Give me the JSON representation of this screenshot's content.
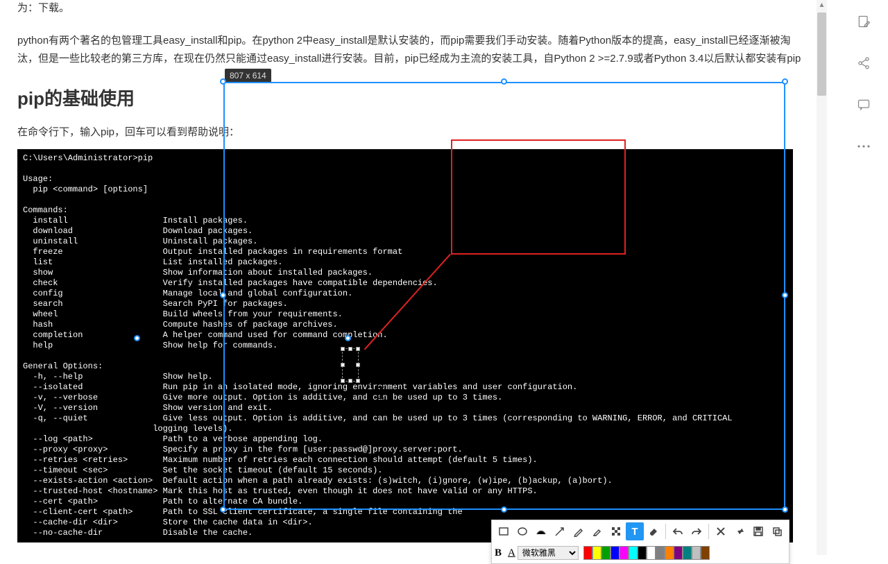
{
  "truncated_top": "为：下载。",
  "para1": "python有两个著名的包管理工具easy_install和pip。在python 2中easy_install是默认安装的，而pip需要我们手动安装。随着Python版本的提高，easy_install已经逐渐被淘汰，但是一些比较老的第三方库，在现在仍然只能通过easy_install进行安装。目前，pip已经成为主流的安装工具，自Python 2 >=2.7.9或者Python 3.4以后默认都安装有pip",
  "heading": "pip的基础使用",
  "para2": "在命令行下，输入pip，回车可以看到帮助说明：",
  "terminal": {
    "prompt": "C:\\Users\\Administrator>pip",
    "usage_header": "Usage:",
    "usage_line": "  pip <command> [options]",
    "commands_header": "Commands:",
    "commands": [
      [
        "  install",
        "Install packages."
      ],
      [
        "  download",
        "Download packages."
      ],
      [
        "  uninstall",
        "Uninstall packages."
      ],
      [
        "  freeze",
        "Output installed packages in requirements format"
      ],
      [
        "  list",
        "List installed packages."
      ],
      [
        "  show",
        "Show information about installed packages."
      ],
      [
        "  check",
        "Verify installed packages have compatible dependencies."
      ],
      [
        "  config",
        "Manage local and global configuration."
      ],
      [
        "  search",
        "Search PyPI for packages."
      ],
      [
        "  wheel",
        "Build wheels from your requirements."
      ],
      [
        "  hash",
        "Compute hashes of package archives."
      ],
      [
        "  completion",
        "A helper command used for command completion."
      ],
      [
        "  help",
        "Show help for commands."
      ]
    ],
    "general_header": "General Options:",
    "options": [
      [
        "  -h, --help",
        "Show help."
      ],
      [
        "  --isolated",
        "Run pip in an isolated mode, ignoring environment variables and user configuration."
      ],
      [
        "  -v, --verbose",
        "Give more output. Option is additive, and can be used up to 3 times."
      ],
      [
        "  -V, --version",
        "Show version and exit."
      ],
      [
        "  -q, --quiet",
        "Give less output. Option is additive, and can be used up to 3 times (corresponding to WARNING, ERROR, and CRITICAL\n                          logging levels)."
      ],
      [
        "  --log <path>",
        "Path to a verbose appending log."
      ],
      [
        "  --proxy <proxy>",
        "Specify a proxy in the form [user:passwd@]proxy.server:port."
      ],
      [
        "  --retries <retries>",
        "Maximum number of retries each connection should attempt (default 5 times)."
      ],
      [
        "  --timeout <sec>",
        "Set the socket timeout (default 15 seconds)."
      ],
      [
        "  --exists-action <action>",
        "Default action when a path already exists: (s)witch, (i)gnore, (w)ipe, (b)ackup, (a)bort)."
      ],
      [
        "  --trusted-host <hostname>",
        "Mark this host as trusted, even though it does not have valid or any HTTPS."
      ],
      [
        "  --cert <path>",
        "Path to alternate CA bundle."
      ],
      [
        "  --client-cert <path>",
        "Path to SSL client certificate, a single file containing the"
      ],
      [
        "  --cache-dir <dir>",
        "Store the cache data in <dir>."
      ],
      [
        "  --no-cache-dir",
        "Disable the cache."
      ]
    ]
  },
  "selection": {
    "size_label": "807 x 614"
  },
  "toolbar": {
    "font_select": "微软雅黑",
    "colors": [
      "#ff0000",
      "#ffff00",
      "#00a000",
      "#0000ff",
      "#ff00ff",
      "#00ffff",
      "#000000",
      "#ffffff",
      "#808080",
      "#ff8000",
      "#800080",
      "#008080",
      "#c0c0c0",
      "#804000"
    ]
  }
}
